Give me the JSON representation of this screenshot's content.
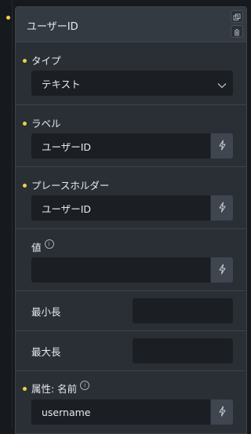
{
  "panel": {
    "title": "ユーザーID",
    "actions": [
      {
        "icon": "copy-icon"
      },
      {
        "icon": "trash-icon"
      }
    ]
  },
  "fields": {
    "type": {
      "label": "タイプ",
      "value": "テキスト",
      "required": true
    },
    "label": {
      "label": "ラベル",
      "value": "ユーザーID",
      "required": true
    },
    "placeholder": {
      "label": "プレースホルダー",
      "value": "ユーザーID",
      "required": true
    },
    "value": {
      "label": "値",
      "value": "",
      "required": false,
      "info": "i"
    },
    "min_length": {
      "label": "最小長",
      "value": ""
    },
    "max_length": {
      "label": "最大長",
      "value": ""
    },
    "attr_name": {
      "label": "属性: 名前",
      "value": "username",
      "required": true,
      "info": "i"
    }
  },
  "colors": {
    "required_dot": "#f2cf45",
    "panel_bg": "#2a2f36",
    "input_bg": "#1b1e23",
    "button_bg": "#3f4650"
  }
}
